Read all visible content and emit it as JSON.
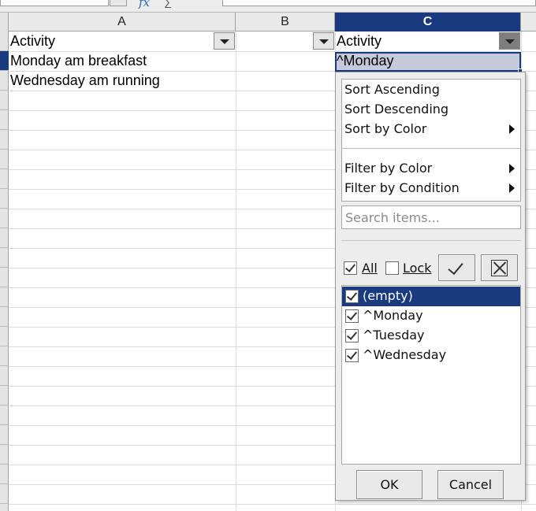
{
  "formula_bar": {
    "fx_icon": "function-icon",
    "sum_icon": "sum-icon"
  },
  "columns": [
    {
      "letter": "A"
    },
    {
      "letter": "B"
    },
    {
      "letter": "C"
    }
  ],
  "cells": {
    "A1": "Activity",
    "A2": "Monday am breakfast",
    "A3": "Wednesday am running",
    "C1": "Activity",
    "C2": "^Monday"
  },
  "autofilter": {
    "menu": {
      "sort_ascending": "Sort Ascending",
      "sort_descending": "Sort Descending",
      "sort_by_color": "Sort by Color",
      "filter_by_color": "Filter by Color",
      "filter_by_condition": "Filter by Condition"
    },
    "search_placeholder": "Search items...",
    "all_label": "All",
    "lock_label": "Lock",
    "all_checked": true,
    "lock_checked": false,
    "items": [
      {
        "label": "(empty)",
        "checked": true,
        "selected": true
      },
      {
        "label": "^Monday",
        "checked": true,
        "selected": false
      },
      {
        "label": "^Tuesday",
        "checked": true,
        "selected": false
      },
      {
        "label": "^Wednesday",
        "checked": true,
        "selected": false
      }
    ],
    "ok_label": "OK",
    "cancel_label": "Cancel"
  },
  "colors": {
    "selection": "#1a3a80",
    "selected_cell_fill": "#c5cadb"
  }
}
